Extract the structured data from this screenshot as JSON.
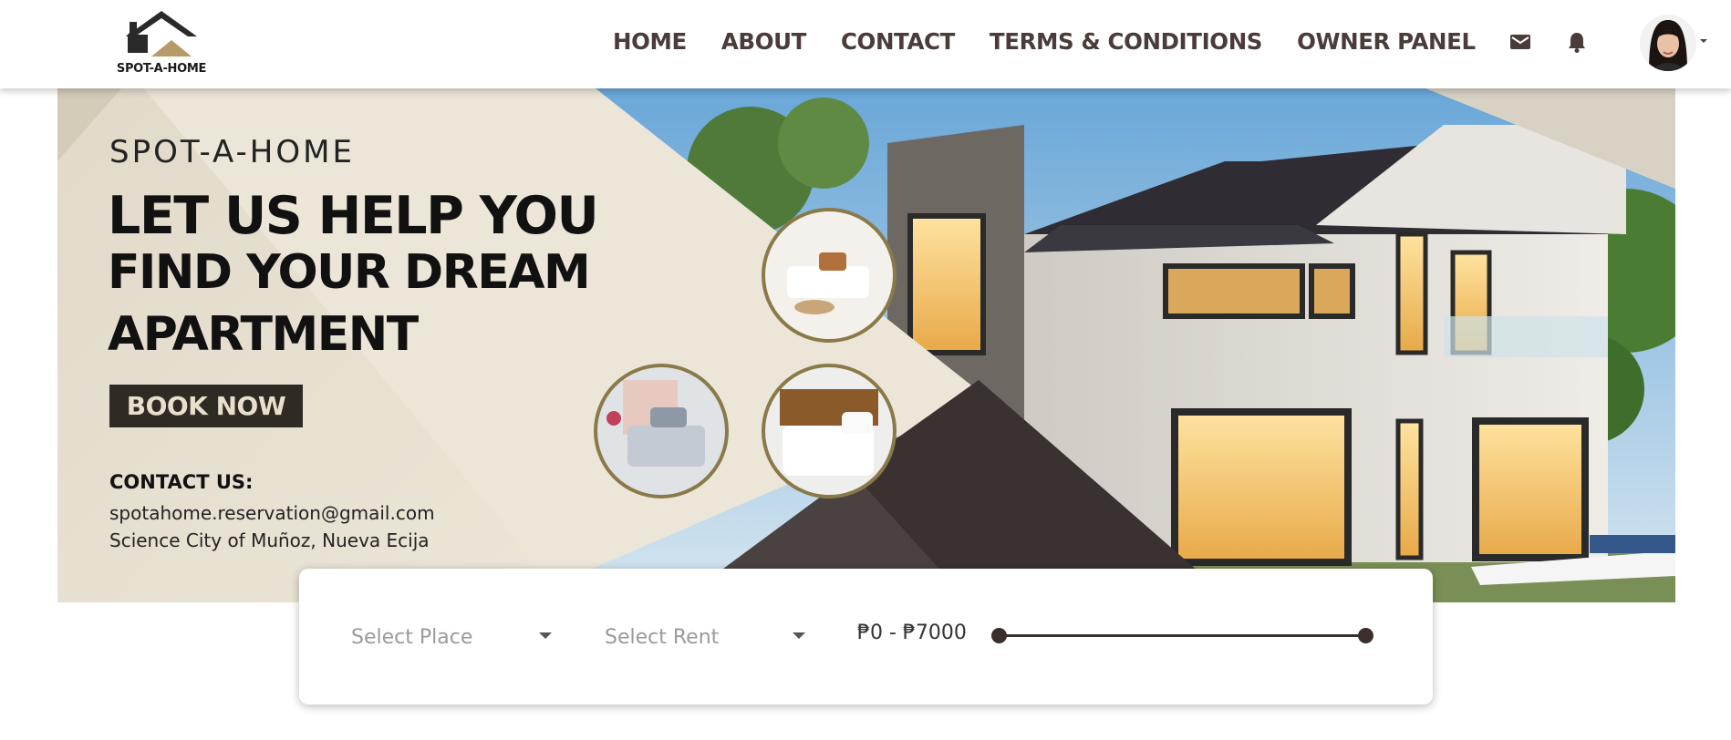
{
  "brand": {
    "logo_text": "SPOT-A-HOME",
    "logo_icon": "house-roof-icon"
  },
  "nav": {
    "links": [
      "HOME",
      "ABOUT",
      "CONTACT",
      "TERMS & CONDITIONS",
      "OWNER PANEL"
    ],
    "icons": [
      "mail-icon",
      "bell-icon"
    ],
    "avatar": "user-avatar",
    "dropdown_icon": "caret-down-icon"
  },
  "hero": {
    "brand": "SPOT-A-HOME",
    "headline_1": "LET US HELP YOU",
    "headline_2": "FIND YOUR DREAM",
    "headline_3": "APARTMENT",
    "cta": "BOOK NOW",
    "contact_heading": "CONTACT US:",
    "contact_email": "spotahome.reservation@gmail.com",
    "contact_address": "Science City of Muñoz, Nueva Ecija"
  },
  "search": {
    "place_placeholder": "Select Place",
    "rent_placeholder": "Select Rent",
    "range_label": "₱0 - ₱7000",
    "range_min": 0,
    "range_max": 7000,
    "range_fill_fraction": 1.0
  },
  "colors": {
    "nav_text": "#4a3c3a",
    "accent_dark": "#3b2f2d",
    "cream": "#ece6d8",
    "gold": "#b79a66"
  }
}
